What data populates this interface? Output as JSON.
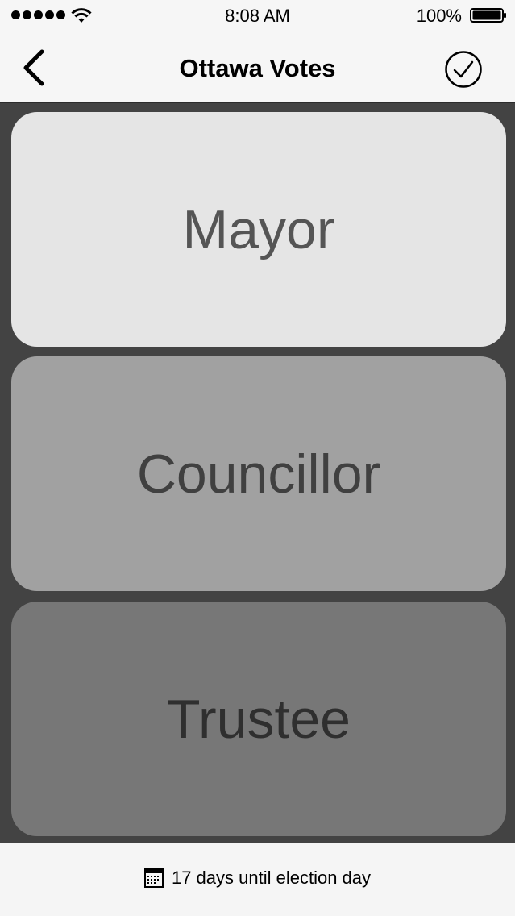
{
  "status_bar": {
    "time": "8:08 AM",
    "battery_percent": "100%",
    "signal_bars": 5
  },
  "nav": {
    "title": "Ottawa Votes",
    "back_icon": "chevron-left-icon",
    "confirm_icon": "check-circle-icon"
  },
  "cards": {
    "mayor": "Mayor",
    "councillor": "Councillor",
    "trustee": "Trustee"
  },
  "footer": {
    "icon": "calendar-icon",
    "countdown": "17 days until election day"
  },
  "colors": {
    "background": "#434343",
    "bar": "#f6f6f6",
    "mayor_card": "#e5e5e5",
    "councillor_card": "#a1a1a1",
    "trustee_card": "#777777"
  }
}
